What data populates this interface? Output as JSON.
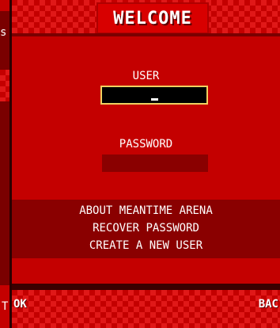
{
  "left_panel": {
    "glyph_top": "s",
    "glyph_bottom": "T"
  },
  "header": {
    "title": "WELCOME"
  },
  "form": {
    "user_label": "USER",
    "user_value": "",
    "password_label": "PASSWORD",
    "password_value": ""
  },
  "menu": {
    "items": [
      "ABOUT MEANTIME ARENA",
      "RECOVER PASSWORD",
      "CREATE A NEW USER"
    ]
  },
  "softkeys": {
    "left": "OK",
    "right": "BAC"
  },
  "colors": {
    "primary_red": "#c40000",
    "dark_red": "#8a0000",
    "input_border": "#f0d060"
  }
}
